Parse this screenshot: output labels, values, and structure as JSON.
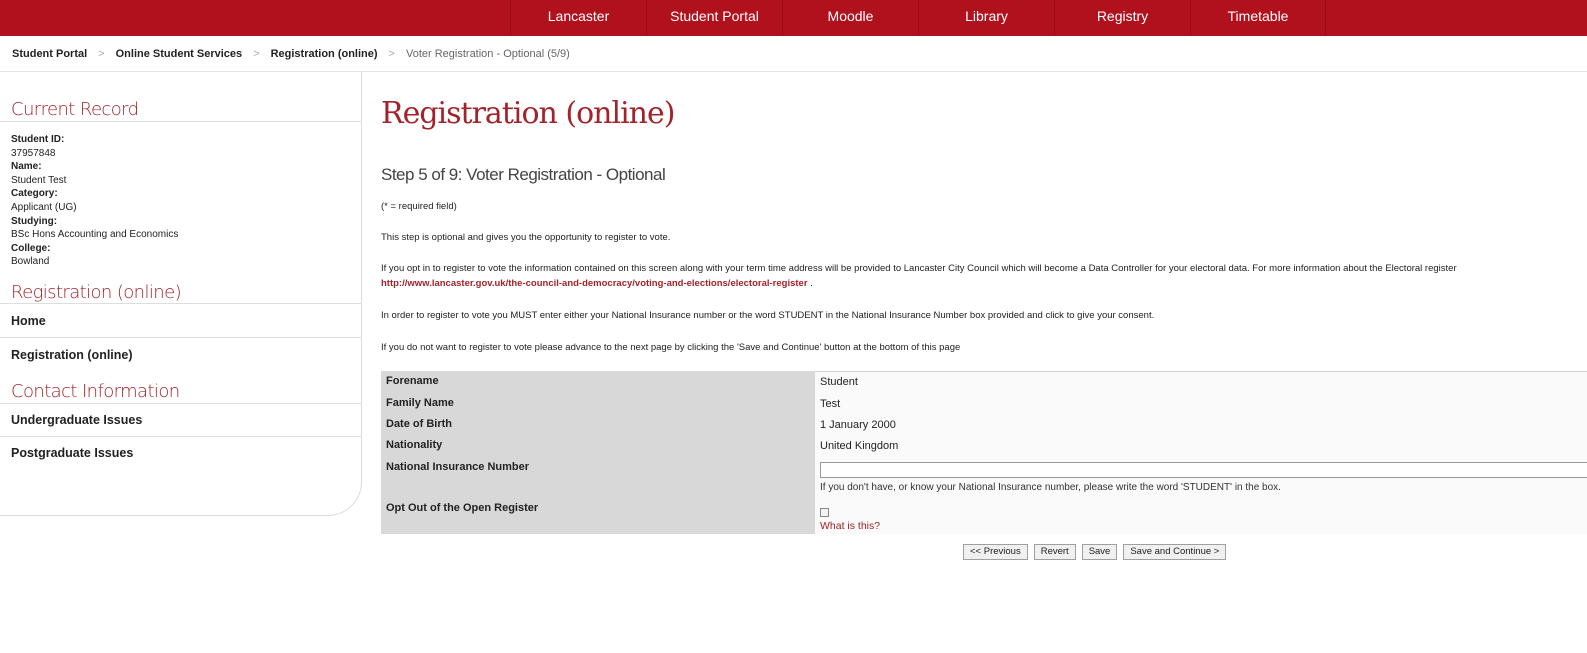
{
  "topnav": {
    "items": [
      "Lancaster",
      "Student Portal",
      "Moodle",
      "Library",
      "Registry",
      "Timetable"
    ]
  },
  "breadcrumb": {
    "items": [
      "Student Portal",
      "Online Student Services",
      "Registration (online)"
    ],
    "current": "Voter Registration - Optional (5/9)",
    "separator": ">"
  },
  "sidebar": {
    "current_record": {
      "heading": "Current Record",
      "fields": [
        {
          "label": "Student ID:",
          "value": "37957848"
        },
        {
          "label": "Name:",
          "value": "Student Test"
        },
        {
          "label": "Category:",
          "value": "Applicant (UG)"
        },
        {
          "label": "Studying:",
          "value": "BSc Hons Accounting and Economics"
        },
        {
          "label": "College:",
          "value": "Bowland"
        }
      ]
    },
    "registration": {
      "heading": "Registration (online)",
      "links": [
        "Home",
        "Registration (online)"
      ]
    },
    "contact": {
      "heading": "Contact Information",
      "links": [
        "Undergraduate Issues",
        "Postgraduate Issues"
      ]
    }
  },
  "main": {
    "title": "Registration (online)",
    "step_title": "Step 5 of 9: Voter Registration - Optional",
    "required_note": "(* = required field)",
    "para1": "This step is optional and gives you the opportunity to register to vote.",
    "para2": "If you opt in to register to vote the information contained on this screen along with your term time address will be provided to Lancaster City Council which will become a Data Controller for your electoral data. For more information about the Electoral register",
    "para2_link": "http://www.lancaster.gov.uk/the-council-and-democracy/voting-and-elections/electoral-register",
    "para2_end": " .",
    "para3": "In order to register to vote you MUST enter either your National Insurance number or the word STUDENT in the National Insurance Number box provided and click to give your consent.",
    "para4": "If you do not want to register to vote please advance to the next page by clicking the 'Save and Continue' button at the bottom of this page"
  },
  "form": {
    "rows": [
      {
        "label": "Forename",
        "value": "Student"
      },
      {
        "label": "Family Name",
        "value": "Test"
      },
      {
        "label": "Date of Birth",
        "value": "1 January 2000"
      },
      {
        "label": "Nationality",
        "value": "United Kingdom"
      }
    ],
    "ni_label": "National Insurance Number",
    "ni_value": "",
    "ni_hint": "If you don't have, or know your National Insurance number, please write the word 'STUDENT' in the box.",
    "optout_label": "Opt Out of the Open Register",
    "optout_checked": false,
    "what_link": "What is this?"
  },
  "buttons": {
    "previous": "<< Previous",
    "revert": "Revert",
    "save": "Save",
    "save_continue": "Save and Continue >"
  },
  "colors": {
    "brand": "#b1111c",
    "heading_red": "#a3232b",
    "label_bg": "#d8d8d8"
  }
}
